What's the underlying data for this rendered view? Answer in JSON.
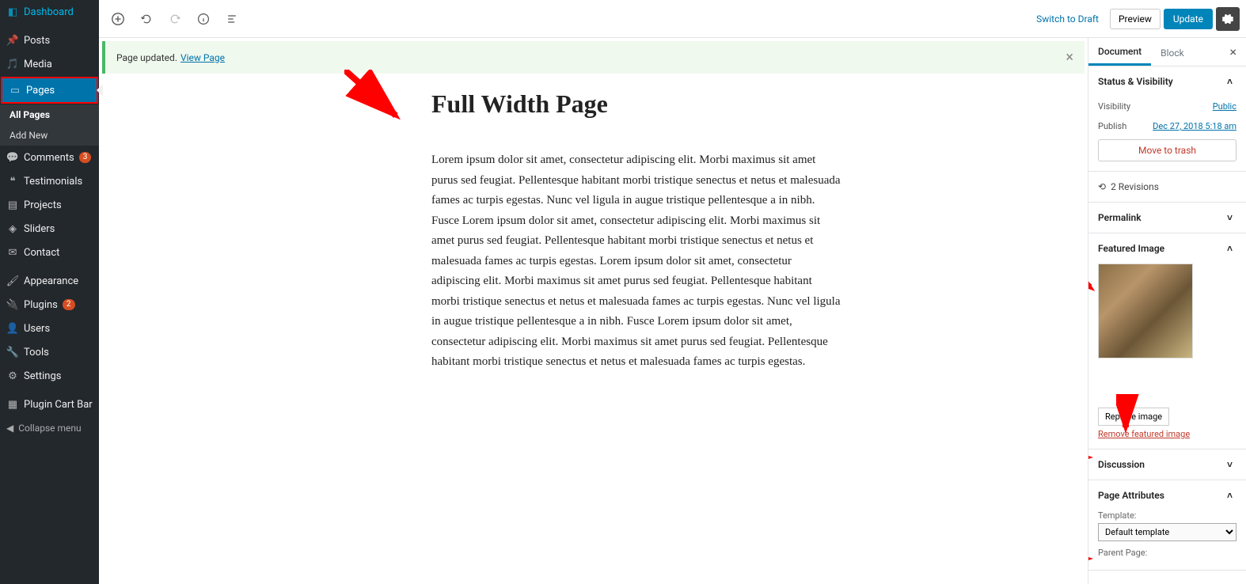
{
  "sidebar": {
    "items": [
      {
        "label": "Dashboard",
        "icon": "dashboard-icon"
      },
      {
        "label": "Posts",
        "icon": "pin-icon"
      },
      {
        "label": "Media",
        "icon": "media-icon"
      },
      {
        "label": "Pages",
        "icon": "page-icon",
        "current": true
      },
      {
        "label": "Comments",
        "icon": "comment-icon",
        "badge": "3"
      },
      {
        "label": "Testimonials",
        "icon": "quote-icon"
      },
      {
        "label": "Projects",
        "icon": "projects-icon"
      },
      {
        "label": "Sliders",
        "icon": "sliders-icon"
      },
      {
        "label": "Contact",
        "icon": "mail-icon"
      },
      {
        "label": "Appearance",
        "icon": "brush-icon"
      },
      {
        "label": "Plugins",
        "icon": "plugin-icon",
        "badge": "2"
      },
      {
        "label": "Users",
        "icon": "users-icon"
      },
      {
        "label": "Tools",
        "icon": "tools-icon"
      },
      {
        "label": "Settings",
        "icon": "settings-icon"
      },
      {
        "label": "Plugin Cart Bar",
        "icon": "cart-icon"
      }
    ],
    "submenu": {
      "all_pages": "All Pages",
      "add_new": "Add New"
    },
    "collapse": "Collapse menu"
  },
  "toolbar": {
    "switch_draft": "Switch to Draft",
    "preview": "Preview",
    "update": "Update"
  },
  "notice": {
    "text": "Page updated.",
    "link": "View Page"
  },
  "post": {
    "title": "Full Width Page",
    "body": "Lorem ipsum dolor sit amet, consectetur adipiscing elit. Morbi maximus sit amet purus sed feugiat. Pellentesque habitant morbi tristique senectus et netus et malesuada fames ac turpis egestas. Nunc vel ligula in augue tristique pellentesque a in nibh. Fusce Lorem ipsum dolor sit amet, consectetur adipiscing elit. Morbi maximus sit amet purus sed feugiat. Pellentesque habitant morbi tristique senectus et netus et malesuada fames ac turpis egestas. Lorem ipsum dolor sit amet, consectetur adipiscing elit. Morbi maximus sit amet purus sed feugiat. Pellentesque habitant morbi tristique senectus et netus et malesuada fames ac turpis egestas. Nunc vel ligula in augue tristique pellentesque a in nibh. Fusce Lorem ipsum dolor sit amet, consectetur adipiscing elit. Morbi maximus sit amet purus sed feugiat. Pellentesque habitant morbi tristique senectus et netus et malesuada fames ac turpis egestas."
  },
  "panel": {
    "tabs": {
      "document": "Document",
      "block": "Block"
    },
    "status": {
      "title": "Status & Visibility",
      "visibility_label": "Visibility",
      "visibility_value": "Public",
      "publish_label": "Publish",
      "publish_value": "Dec 27, 2018 5:18 am",
      "trash": "Move to trash"
    },
    "revisions": {
      "count": "2 Revisions"
    },
    "permalink": "Permalink",
    "featured": {
      "title": "Featured Image",
      "replace": "Replace image",
      "remove": "Remove featured image"
    },
    "discussion": "Discussion",
    "page_attrs": {
      "title": "Page Attributes",
      "template_label": "Template:",
      "template_value": "Default template",
      "parent_label": "Parent Page:"
    }
  }
}
